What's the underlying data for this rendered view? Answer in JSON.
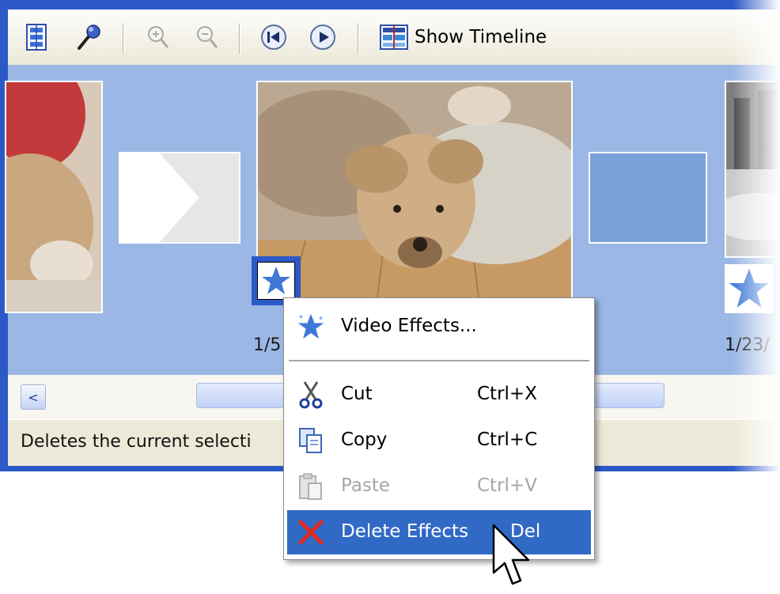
{
  "toolbar": {
    "buttons": [
      {
        "name": "storyboard-icon"
      },
      {
        "name": "narrate-microphone-icon"
      },
      {
        "name": "zoom-in-icon"
      },
      {
        "name": "zoom-out-icon"
      },
      {
        "name": "rewind-icon"
      },
      {
        "name": "play-icon"
      }
    ],
    "timeline_label": "Show Timeline"
  },
  "storyboard": {
    "durations": [
      "1/5",
      "1/23/"
    ]
  },
  "scrollbar": {
    "left_arrow": "<"
  },
  "status_bar": {
    "text": "Deletes the current selecti"
  },
  "context_menu": {
    "items": [
      {
        "label": "Video Effects...",
        "shortcut": "",
        "icon": "video-effects-star-icon",
        "enabled": true
      },
      {
        "label": "Cut",
        "shortcut": "Ctrl+X",
        "icon": "scissors-icon",
        "enabled": true
      },
      {
        "label": "Copy",
        "shortcut": "Ctrl+C",
        "icon": "copy-icon",
        "enabled": true
      },
      {
        "label": "Paste",
        "shortcut": "Ctrl+V",
        "icon": "paste-icon",
        "enabled": false
      },
      {
        "label": "Delete Effects",
        "shortcut": "Del",
        "icon": "delete-x-icon",
        "enabled": true,
        "highlighted": true
      }
    ]
  },
  "colors": {
    "window_frame": "#2c59c8",
    "storyboard_bg": "#9bb7e5",
    "menu_highlight": "#316ac5",
    "delete_icon": "#e0291f"
  }
}
